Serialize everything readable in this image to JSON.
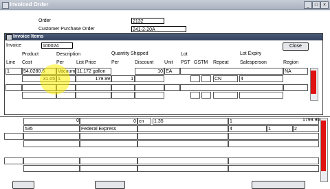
{
  "window": {
    "title": "Invoiced Order"
  },
  "header": {
    "order_label": "Order",
    "order_value": "2132",
    "cpo_label": "Customer Purchase Order",
    "cpo_value": "241-2-20A"
  },
  "dialog": {
    "title": "Invoice Items",
    "invoice_label": "Invoice",
    "invoice_value": "100024",
    "close_label": "Close",
    "columns_row1": [
      "Product",
      "Description",
      "Quantity Shipped",
      "Lot",
      "Lot Expiry"
    ],
    "columns_row2": [
      "Line",
      "Cost",
      "Per",
      "List Price",
      "Per",
      "Discount",
      "Unit",
      "PST",
      "GSTM",
      "Repeat",
      "Salesperson",
      "Region"
    ],
    "row1": {
      "line": "1",
      "product": "54.0280.6",
      "description": "Vacuum",
      "list_price": "11.172 gallon",
      "discount": "10",
      "unit": "EA",
      "region": "NA"
    },
    "row2": {
      "cost": "31.05",
      "per": "1",
      "list_price": "179.99",
      "qty_per": "1",
      "repeat": "CN",
      "salesperson": "4"
    }
  },
  "lower": {
    "r1": {
      "a": "0",
      "b": "0",
      "c": "cn",
      "d": "1.35",
      "e": "1",
      "f": "1799.90"
    },
    "r2": {
      "a": "535",
      "b": "Federal Express",
      "c": "4",
      "d": "1",
      "e": "2"
    }
  },
  "colors": {
    "titlebar": "#33425e",
    "scroll_red": "#e01111",
    "highlight": "#fff000"
  }
}
